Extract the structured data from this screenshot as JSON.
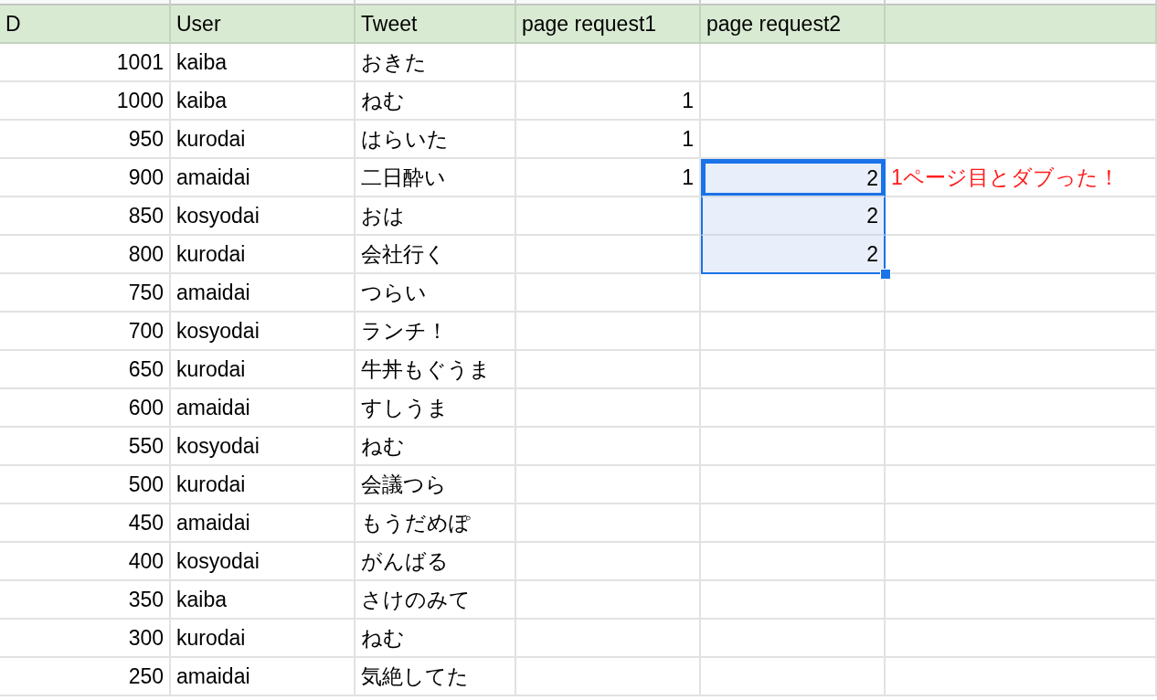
{
  "columns": [
    "D",
    "User",
    "Tweet",
    "page request1",
    "page request2"
  ],
  "rows": [
    {
      "id": "1001",
      "user": "kaiba",
      "tweet": "おきた",
      "page_request2": {
        "selected": false,
        "active": false
      }
    },
    {
      "id": "1000",
      "user": "kaiba",
      "tweet": "ねむ",
      "page_request1": "1",
      "page_request2": {
        "selected": false,
        "active": false
      }
    },
    {
      "id": "950",
      "user": "kurodai",
      "tweet": "はらいた",
      "page_request1": "1",
      "page_request2": {
        "selected": false,
        "active": false
      }
    },
    {
      "id": "900",
      "user": "amaidai",
      "tweet": "二日酔い",
      "page_request1": "1",
      "page_request2": {
        "text": "2",
        "selected": true,
        "active": true
      },
      "note": "1ページ目とダブった！"
    },
    {
      "id": "850",
      "user": "kosyodai",
      "tweet": "おは",
      "page_request2": {
        "text": "2",
        "selected": true,
        "active": false
      }
    },
    {
      "id": "800",
      "user": "kurodai",
      "tweet": "会社行く",
      "page_request2": {
        "text": "2",
        "selected": true,
        "active": false
      }
    },
    {
      "id": "750",
      "user": "amaidai",
      "tweet": "つらい",
      "page_request2": {
        "selected": false,
        "active": false
      }
    },
    {
      "id": "700",
      "user": "kosyodai",
      "tweet": "ランチ！",
      "page_request2": {
        "selected": false,
        "active": false
      }
    },
    {
      "id": "650",
      "user": "kurodai",
      "tweet": "牛丼もぐうま",
      "page_request2": {
        "selected": false,
        "active": false
      }
    },
    {
      "id": "600",
      "user": "amaidai",
      "tweet": "すしうま",
      "page_request2": {
        "selected": false,
        "active": false
      }
    },
    {
      "id": "550",
      "user": "kosyodai",
      "tweet": "ねむ",
      "page_request2": {
        "selected": false,
        "active": false
      }
    },
    {
      "id": "500",
      "user": "kurodai",
      "tweet": "会議つら",
      "page_request2": {
        "selected": false,
        "active": false
      }
    },
    {
      "id": "450",
      "user": "amaidai",
      "tweet": "もうだめぽ",
      "page_request2": {
        "selected": false,
        "active": false
      }
    },
    {
      "id": "400",
      "user": "kosyodai",
      "tweet": "がんばる",
      "page_request2": {
        "selected": false,
        "active": false
      }
    },
    {
      "id": "350",
      "user": "kaiba",
      "tweet": "さけのみて",
      "page_request2": {
        "selected": false,
        "active": false
      }
    },
    {
      "id": "300",
      "user": "kurodai",
      "tweet": "ねむ",
      "page_request2": {
        "selected": false,
        "active": false
      }
    },
    {
      "id": "250",
      "user": "amaidai",
      "tweet": "気絶してた",
      "page_request2": {
        "selected": false,
        "active": false
      }
    }
  ]
}
